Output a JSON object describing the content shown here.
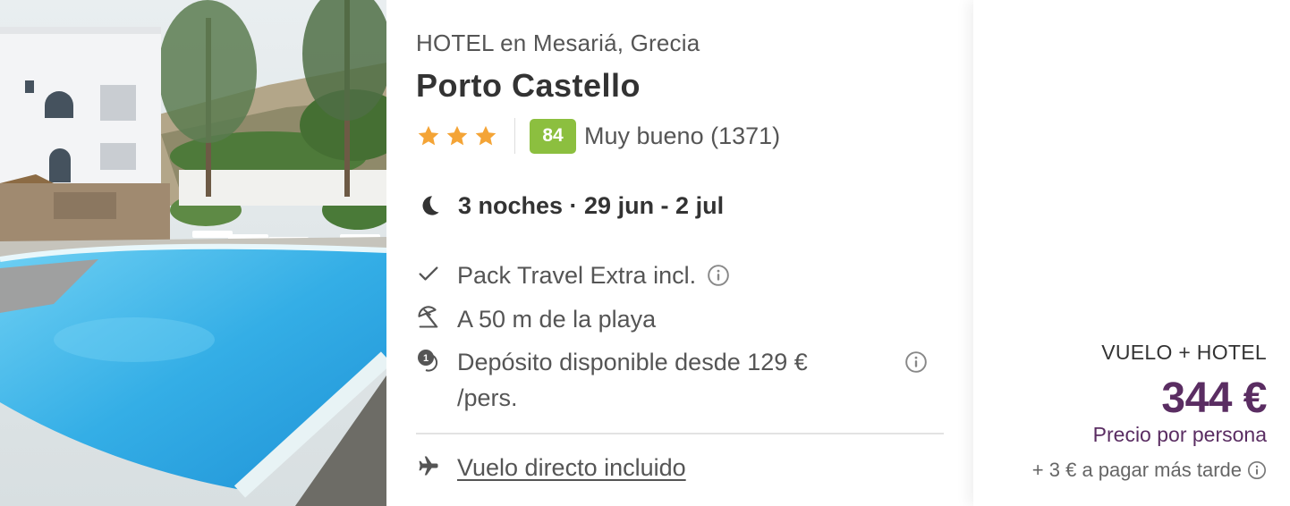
{
  "hotel": {
    "subtitle": "HOTEL en Mesariá, Grecia",
    "name": "Porto Castello",
    "stars": 3,
    "score": "84",
    "score_text": "Muy bueno (1371)"
  },
  "stay": {
    "text": "3 noches · 29 jun - 2 jul",
    "icon": "moon-icon"
  },
  "features": [
    {
      "icon": "check-icon",
      "text": "Pack Travel Extra incl."
    },
    {
      "icon": "beach-umbrella-icon",
      "text": "A 50 m de la playa"
    },
    {
      "icon": "deposit-icon",
      "text": "Depósito disponible desde 129 €",
      "text2": "/pers."
    }
  ],
  "flight": {
    "icon": "plane-icon",
    "text": "Vuelo directo incluido"
  },
  "price": {
    "type": "VUELO + HOTEL",
    "amount": "344 €",
    "note": "Precio por persona",
    "later": "+ 3 € a pagar más tarde"
  },
  "colors": {
    "score_bg": "#8cbf3f",
    "price": "#5a2d62",
    "star": "#f4a436"
  }
}
